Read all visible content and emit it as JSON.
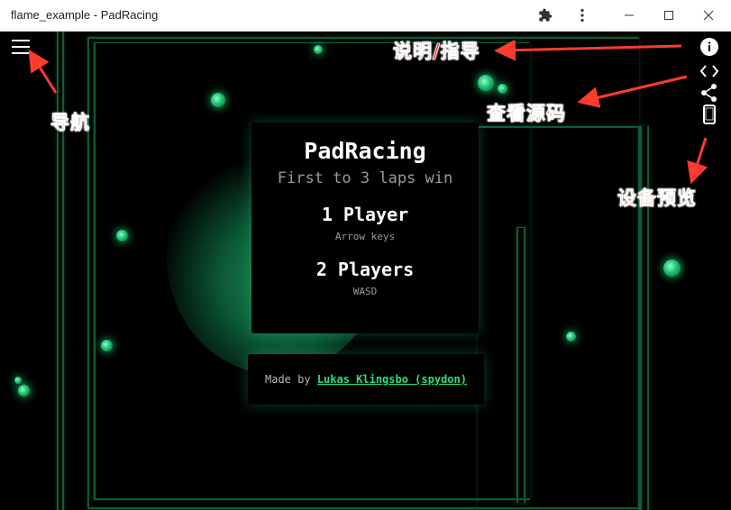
{
  "window": {
    "title": "flame_example - PadRacing"
  },
  "game": {
    "title": "PadRacing",
    "subtitle": "First to 3 laps win",
    "one_player": {
      "label": "1 Player",
      "hint": "Arrow keys"
    },
    "two_players": {
      "label": "2 Players",
      "hint": "WASD"
    },
    "credit_prefix": "Made by",
    "credit_link": "Lukas Klingsbo (spydon)",
    "accent_color": "#28e07f"
  },
  "toolbar": {
    "icons": [
      "extensions-icon",
      "more-vert-icon",
      "minimize-icon",
      "maximize-icon",
      "close-icon"
    ]
  },
  "right_tools": [
    "info-icon",
    "code-icon",
    "share-icon",
    "phone-icon"
  ],
  "annotations": {
    "docs": "说明/指导",
    "view_source": "查看源码",
    "device_preview": "设备预览",
    "navigation": "导航",
    "color": "#ff3b2f"
  }
}
